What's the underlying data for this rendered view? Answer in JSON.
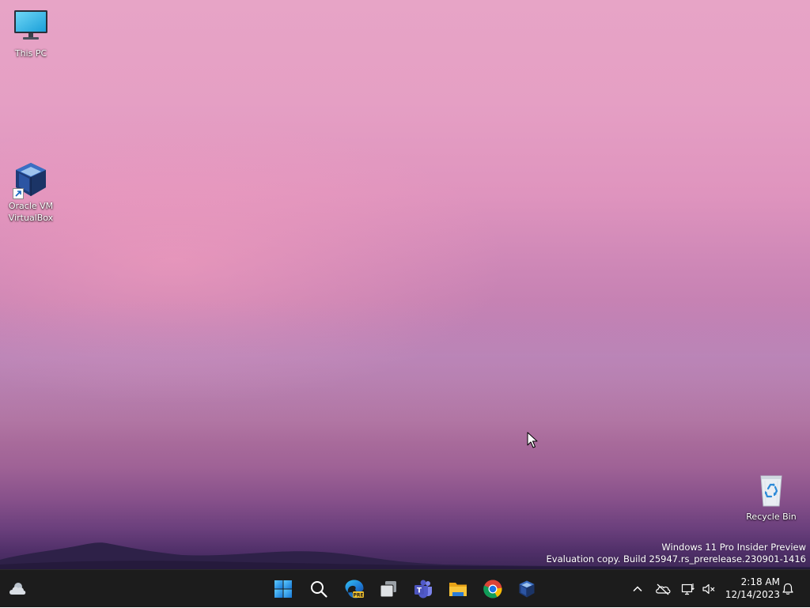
{
  "desktop": {
    "icons": [
      {
        "label": "This PC",
        "icon": "monitor-icon"
      },
      {
        "label": "Oracle VM VirtualBox",
        "icon": "virtualbox-icon"
      },
      {
        "label": "Recycle Bin",
        "icon": "recycle-bin-icon"
      }
    ],
    "watermark": {
      "line1": "Windows 11 Pro Insider Preview",
      "line2": "Evaluation copy. Build 25947.rs_prerelease.230901-1416"
    }
  },
  "taskbar": {
    "weather_icon": "cloudy-weather-icon",
    "apps": [
      {
        "name": "Start",
        "icon": "windows-start-icon"
      },
      {
        "name": "Search",
        "icon": "search-icon"
      },
      {
        "name": "Microsoft Edge Canary",
        "icon": "edge-preview-icon",
        "badge": "PRE"
      },
      {
        "name": "Task View",
        "icon": "task-view-icon"
      },
      {
        "name": "Microsoft Teams",
        "icon": "teams-icon",
        "badge": "T"
      },
      {
        "name": "File Explorer",
        "icon": "folder-icon"
      },
      {
        "name": "Google Chrome",
        "icon": "chrome-icon"
      },
      {
        "name": "Oracle VM VirtualBox",
        "icon": "virtualbox-icon"
      }
    ],
    "tray": {
      "icons": [
        "chevron-up-icon",
        "onedrive-offline-icon",
        "network-icon",
        "speaker-muted-icon"
      ],
      "time": "2:18 AM",
      "date": "12/14/2023",
      "notification_icon": "bell-icon"
    }
  },
  "colors": {
    "taskbar_bg": "#1c1c1c",
    "accent": "#0078d4",
    "wallpaper_top": "#e7a4c6",
    "wallpaper_bottom": "#3e2858"
  }
}
